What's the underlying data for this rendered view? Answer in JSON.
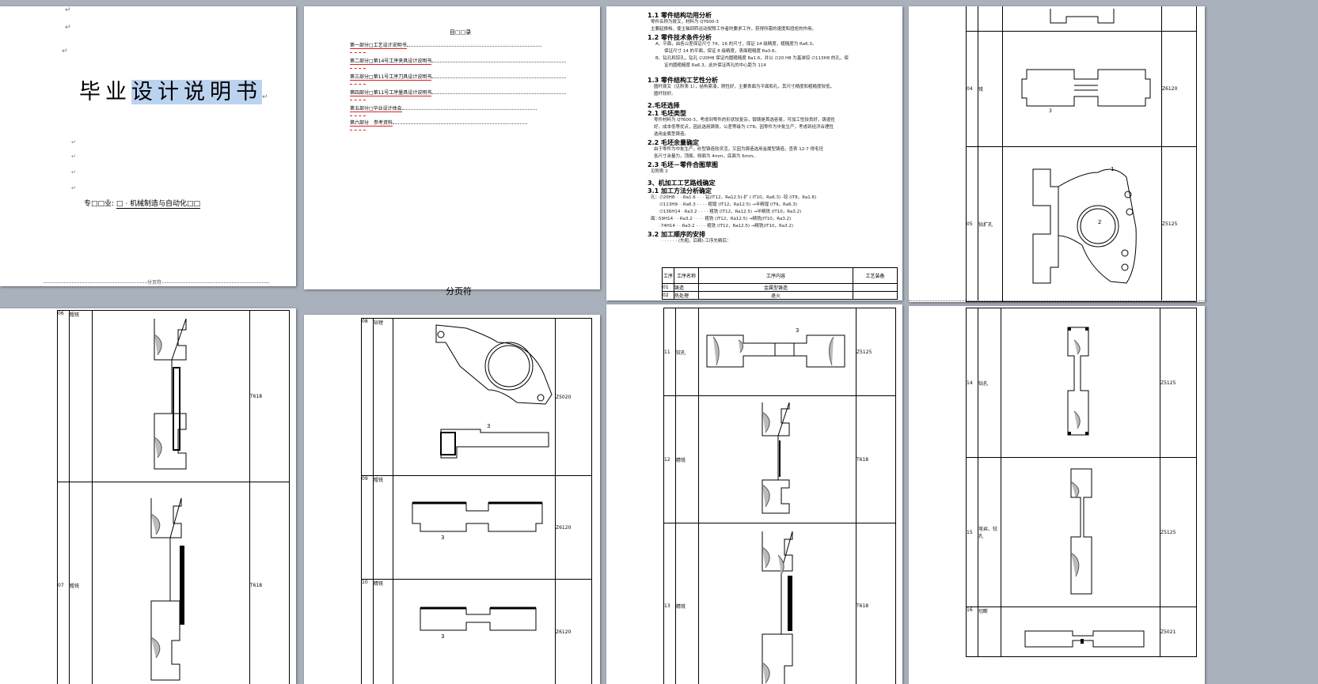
{
  "window": {
    "background": "#a9b1bc",
    "accent": "#e02020"
  },
  "page1": {
    "title_plain": "毕业",
    "title_selected": "设计说明书",
    "major_label": "专□□业:",
    "major_value": "□ · 机械制造与自动化□□",
    "page_break_label": "分页符"
  },
  "page2": {
    "toc_title": "目□□录",
    "toc_items": [
      "第一部分□工艺设计说明书",
      "第二部分□第14号工序夹具设计说明书",
      "第三部分□第11号工序刀具设计说明书",
      "第四部分□第11号工序量具设计说明书",
      "第五部分□毕业设计体会",
      "第六部分　参考资料"
    ],
    "page_break_label": "分页符"
  },
  "page3": {
    "headings": [
      "1.1 零件结构功用分析",
      "1.2 零件技术条件分析",
      "1.3 零件结构工艺性分析",
      "2.毛坯选择",
      "2.1 毛坯类型",
      "2.2 毛坯余量确定",
      "2.3 毛坯－零件合图草图",
      "3、机加工工艺路线确定",
      "3.1 加工方法分析确定",
      "3.2 加工顺序的安排"
    ],
    "lines_a": [
      "零件名称为拨叉，材料为 QT600-3",
      "主要起换档，使主轴回转运动按照工作者的要求工作，获得所需的速度和扭矩的作用。"
    ],
    "lines_b": [
      "A、平面，由各公差保证尺寸 74、16 的尺寸，保证 14 级精度，粗糙度为 Ra6.3。",
      "　　保证尺寸 14 的平面，保证 8 级精度，表面粗糙度 Ra3.6。",
      "B、钻孔和铰孔，钻孔 ∅20H8 保证内圆粗糙度 Ra1.6，并以 ∅20 H8 为基准铰 ∅113H8 的孔，保",
      "　　证内圆粗糙度 Ra6.3，此外保证两孔的中心距为 114"
    ],
    "lines_c": [
      "圆杆拨叉（见附表 1），结构紧凑，刚性好，主要表面为平面和孔，其尺寸精度和粗糙度较低，",
      "圆杆较好。"
    ],
    "lines_d": [
      "零件材料为 QT600-3，考虑到零件的形状较复杂，锻铸是首选容易，可加工性较良好，铸造性",
      "好，成本低等优点，因此选用铸铁，公差等级为 CT8。因零件为中批生产，考虑到经济合理性",
      "选用金属型铸造。"
    ],
    "lines_e": [
      "由于零件为中批生产，砂型铸造较灵活，又因为铸造选用金属型铸造，查表 12-7 得毛坯",
      "各尺寸余量为，顶面，侧面为 4mm，底面为 6mm。"
    ],
    "lines_f": [
      "见附表 2"
    ],
    "lines_g": [
      "孔：∅20H8· · · Ra1.6 · · · 钻(IT12，Ra12.5)-扩 (·IT10，Ra6.3) -铰 (IT8，Ra1.6)",
      "　　∅113H9· · Ra6.3 · · · · 粗镗 (IT12，Ra12.5) →半精镗 (IT9，Ra6.3)",
      "　　∅136H14 · Ra3.2 · · · · 粗铣 (IT12，Ra12.5) →半精铣 (IT10，Ra3.2)",
      "面：·59H14 · · Ra3.2 · · · · 粗铣 (IT12，Ra12.5) →精铣(IT10，Ra3.2)",
      "　　·74H14 · · Ra3.2 · · · · 粗铣 (IT12，Ra12.5) →精铣(IT10，Ra3.2)"
    ],
    "line_h": "· · · · · · (先粗，后精)·工序先精后：",
    "table_head": [
      "工序",
      "工序名称",
      "工序内容",
      "工艺装备"
    ],
    "table_rows": [
      {
        "no": "01",
        "name": "铸造",
        "content": "金属型铸造"
      },
      {
        "no": "02",
        "name": "热处理",
        "content": "退火"
      }
    ]
  },
  "page4_top": {
    "rows": [
      {
        "no": "04",
        "name": "铣",
        "equip": "Z6120"
      },
      {
        "no": "05",
        "name": "钻扩孔",
        "equip": "Z5125"
      }
    ]
  },
  "page5": {
    "rows": [
      {
        "no": "06",
        "name": "粗铣",
        "equip": "T618"
      },
      {
        "no": "07",
        "name": "粗铣",
        "equip": "T618"
      }
    ]
  },
  "page6": {
    "rows": [
      {
        "no": "08",
        "name": "钻镗",
        "equip": "Z5020"
      },
      {
        "no": "09",
        "name": "粗铣",
        "equip": "Z6120"
      },
      {
        "no": "10",
        "name": "精铣",
        "equip": "Z6120"
      }
    ]
  },
  "page7": {
    "rows": [
      {
        "no": "11",
        "name": "铰孔",
        "equip": "Z5125"
      },
      {
        "no": "12",
        "name": "精铣",
        "equip": "T618"
      },
      {
        "no": "13",
        "name": "精铣",
        "equip": "T618"
      }
    ]
  },
  "page8": {
    "rows": [
      {
        "no": "14",
        "name": "钻孔",
        "equip": "Z5125"
      },
      {
        "no": "15",
        "name": "攻丝、铰孔",
        "equip": "Z5125"
      },
      {
        "no": "16",
        "name": "切断",
        "equip": "Z5021"
      }
    ]
  }
}
